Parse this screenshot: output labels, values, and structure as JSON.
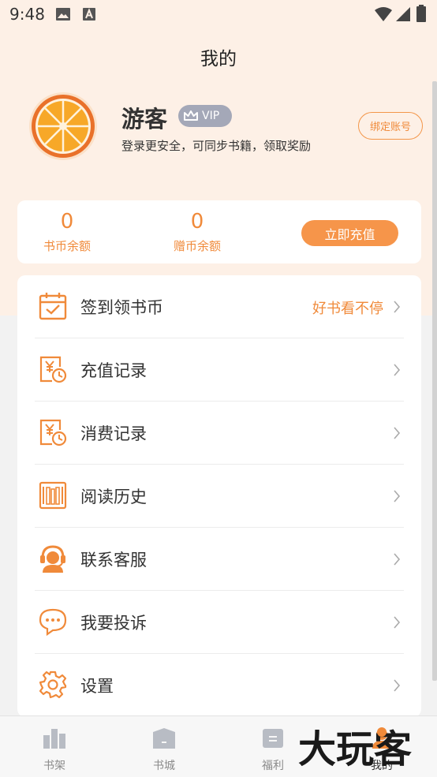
{
  "status_bar": {
    "time": "9:48"
  },
  "header": {
    "title": "我的"
  },
  "profile": {
    "username": "游客",
    "vip_label": "VIP",
    "subtitle": "登录更安全，可同步书籍，领取奖励",
    "bind_button": "绑定账号"
  },
  "balance": {
    "coin_value": "0",
    "coin_label": "书币余额",
    "gift_value": "0",
    "gift_label": "赠币余额",
    "recharge_button": "立即充值"
  },
  "menu": [
    {
      "label": "签到领书币",
      "hint": "好书看不停",
      "icon": "calendar-check-icon"
    },
    {
      "label": "充值记录",
      "icon": "recharge-record-icon"
    },
    {
      "label": "消费记录",
      "icon": "consume-record-icon"
    },
    {
      "label": "阅读历史",
      "icon": "bookshelf-history-icon"
    },
    {
      "label": "联系客服",
      "icon": "customer-service-icon"
    },
    {
      "label": "我要投诉",
      "icon": "chat-bubble-icon"
    },
    {
      "label": "设置",
      "icon": "gear-icon"
    }
  ],
  "tabbar": [
    {
      "label": "书架",
      "icon": "bookshelf-icon"
    },
    {
      "label": "书城",
      "icon": "store-icon"
    },
    {
      "label": "福利",
      "icon": "welfare-icon"
    },
    {
      "label": "我的",
      "icon": "profile-icon",
      "active": true
    }
  ],
  "watermark": {
    "text": "大玩客"
  },
  "colors": {
    "accent": "#f08a3a",
    "header_bg": "#fdf0e6",
    "page_bg": "#f2f2f2",
    "vip_badge": "#a4a8b8"
  }
}
